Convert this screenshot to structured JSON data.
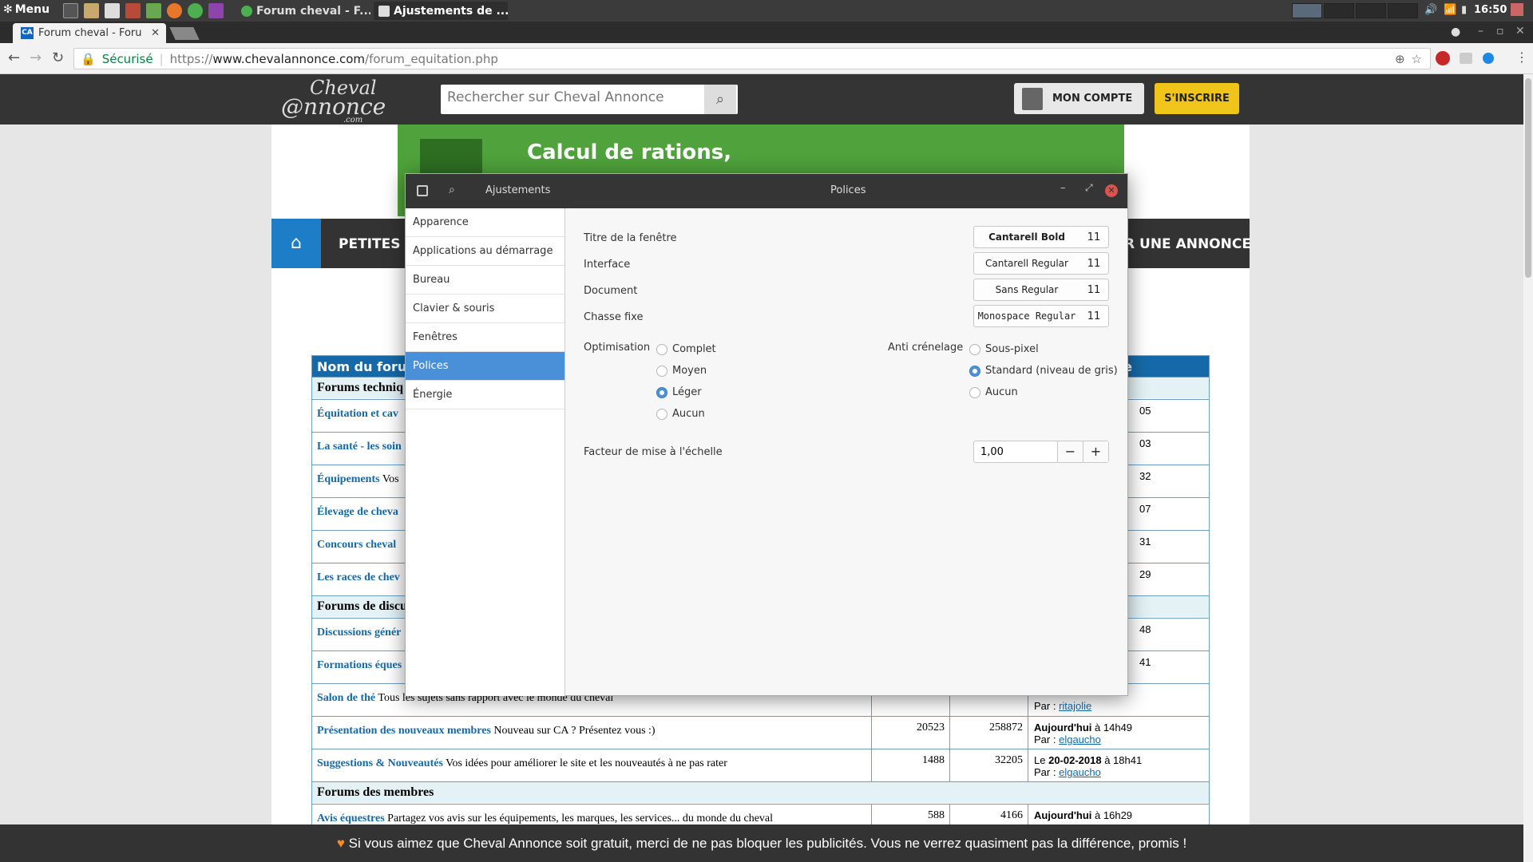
{
  "taskbar": {
    "menu_label": "Menu",
    "tasks": [
      "Forum cheval - F...",
      "Ajustements de ..."
    ],
    "clock": "16:50"
  },
  "browser": {
    "tab_title": "Forum cheval - Forum",
    "tab_favicon": "CA",
    "secure_label": "Sécurisé",
    "url_scheme": "https://",
    "url_host": "www.chevalannonce.com",
    "url_path": "/forum_equitation.php"
  },
  "site": {
    "logo_line1": "Cheval",
    "logo_line2": "@nnonce",
    "logo_line3": ".com",
    "search_placeholder": "Rechercher sur Cheval Annonce",
    "account_label": "MON COMPTE",
    "signup_label": "S'INSCRIRE",
    "banner_text": "Calcul de rations,",
    "nav_left": "PETITES A",
    "nav_right": "R UNE ANNONCE",
    "notice": "Si vous aimez que Cheval Annonce soit gratuit, merci de ne pas bloquer les publicités. Vous ne verrez quasiment pas la différence, promis !"
  },
  "forum": {
    "header_col1": "Nom du forum",
    "header_col4": "essage",
    "rows": [
      {
        "type": "section",
        "name": "Forums techniq"
      },
      {
        "type": "row",
        "name": "Équitation et cav",
        "desc": "",
        "last": "05"
      },
      {
        "type": "row",
        "name": "La santé - les soin",
        "desc": "",
        "last": "03"
      },
      {
        "type": "row",
        "name": "Équipements",
        "desc": "Vos",
        "last": "32"
      },
      {
        "type": "row",
        "name": "Élevage de cheva",
        "desc": "",
        "last": "07"
      },
      {
        "type": "row",
        "name": "Concours cheval",
        "desc": "",
        "last": "31"
      },
      {
        "type": "row",
        "name": "Les races de chev",
        "desc": "",
        "last": "29"
      },
      {
        "type": "section",
        "name": "Forums de discu"
      },
      {
        "type": "row",
        "name": "Discussions génér",
        "desc": "",
        "last": "48"
      },
      {
        "type": "row",
        "name": "Formations éques",
        "desc": "",
        "last": "41"
      },
      {
        "type": "row",
        "name": "Salon de thé",
        "desc": "Tous les sujets sans rapport avec le monde du cheval",
        "last_date": "",
        "last_by": "ritajolie"
      },
      {
        "type": "row",
        "name": "Présentation des nouveaux membres",
        "desc": "Nouveau sur CA ? Présentez vous :)",
        "topics": "20523",
        "posts": "258872",
        "last_date": "Aujourd'hui",
        "last_time": "à 14h49",
        "last_by": "elgaucho"
      },
      {
        "type": "row",
        "name": "Suggestions & Nouveautés",
        "desc": "Vos idées pour améliorer le site et les nouveautés à ne pas rater",
        "topics": "1488",
        "posts": "32205",
        "last_prefix": "Le",
        "last_date": "20-02-2018",
        "last_time": "à 18h41",
        "last_by": "elgaucho"
      },
      {
        "type": "section",
        "name": "Forums des membres"
      },
      {
        "type": "row",
        "name": "Avis équestres",
        "desc": "Partagez vos avis sur les équipements, les marques, les services... du monde du cheval",
        "topics": "588",
        "posts": "4166",
        "last_date": "Aujourd'hui",
        "last_time": "à 16h29"
      }
    ],
    "par_label": "Par :"
  },
  "dialog": {
    "app_name": "Ajustements",
    "title": "Polices",
    "sidebar": [
      "Apparence",
      "Applications au démarrage",
      "Bureau",
      "Clavier & souris",
      "Fenêtres",
      "Polices",
      "Énergie"
    ],
    "active_item": "Polices",
    "fonts": [
      {
        "label": "Titre de la fenêtre",
        "font": "Cantarell Bold",
        "size": "11"
      },
      {
        "label": "Interface",
        "font": "Cantarell Regular",
        "size": "11"
      },
      {
        "label": "Document",
        "font": "Sans Regular",
        "size": "11"
      },
      {
        "label": "Chasse fixe",
        "font": "Monospace Regular",
        "size": "11"
      }
    ],
    "hinting_label": "Optimisation",
    "hinting_options": [
      "Complet",
      "Moyen",
      "Léger",
      "Aucun"
    ],
    "hinting_selected": "Léger",
    "antialias_label": "Anti crénelage",
    "antialias_options": [
      "Sous-pixel",
      "Standard (niveau de gris)",
      "Aucun"
    ],
    "antialias_selected": "Standard (niveau de gris)",
    "scale_label": "Facteur de mise à l'échelle",
    "scale_value": "1,00",
    "minus": "−",
    "plus": "+"
  }
}
